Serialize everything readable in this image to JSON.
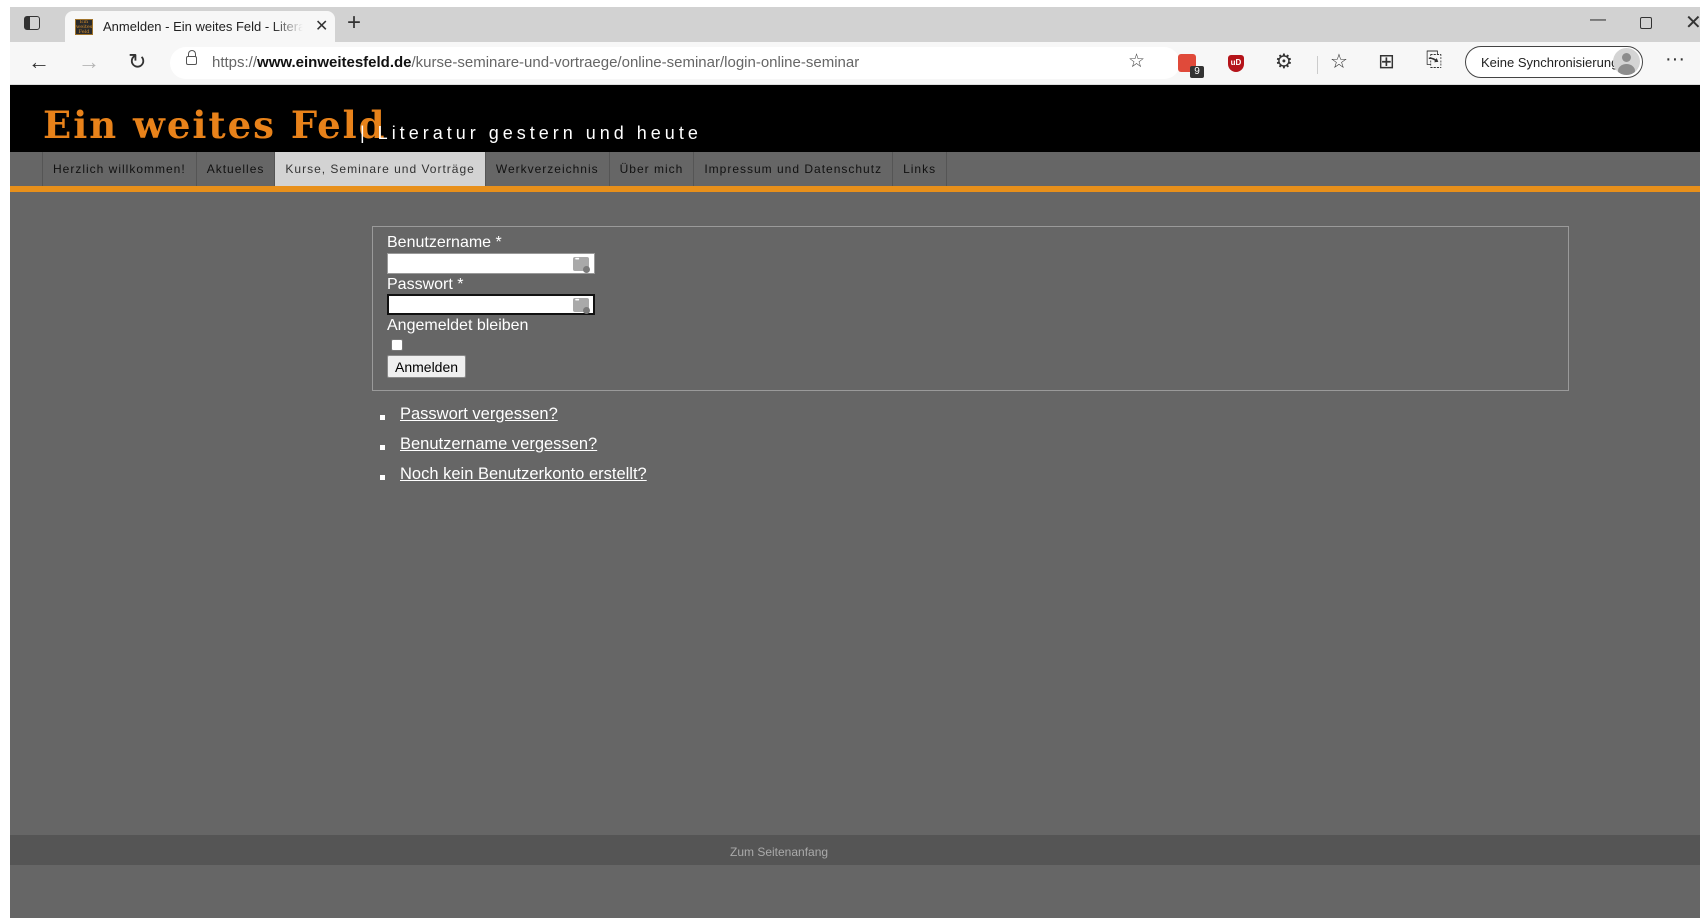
{
  "browser": {
    "tab_title": "Anmelden - Ein weites Feld - Literatur gestern und heute",
    "favicon_text": "Ein weites Feld",
    "url_prefix": "https://",
    "url_domain": "www.einweitesfeld.de",
    "url_path": "/kurse-seminare-und-vortraege/online-seminar/login-online-seminar",
    "sync_label": "Keine Synchronisierung",
    "extension_badge": "9",
    "extension_ublock_label": "uD",
    "icons": {
      "back": "←",
      "forward": "→",
      "reload": "↻",
      "new_tab": "+",
      "close": "✕",
      "minimize": "—",
      "more": "···",
      "favorites_add": "☆",
      "extensions": "⚙",
      "favorites": "☆",
      "collections": "⊞",
      "share": "⎘"
    }
  },
  "site": {
    "logo": "Ein weites Feld",
    "tagline": "| Literatur gestern und heute",
    "accent_color": "#e8901b",
    "nav": [
      {
        "label": "Herzlich willkommen!"
      },
      {
        "label": "Aktuelles"
      },
      {
        "label": "Kurse, Seminare und Vorträge"
      },
      {
        "label": "Werkverzeichnis"
      },
      {
        "label": "Über mich"
      },
      {
        "label": "Impressum und Datenschutz"
      },
      {
        "label": "Links"
      }
    ],
    "active_nav": "Kurse, Seminare und Vorträge"
  },
  "login": {
    "username_label": "Benutzername *",
    "username_value": "",
    "password_label": "Passwort *",
    "password_value": "",
    "remember_label": "Angemeldet bleiben",
    "remember_checked": false,
    "submit_label": "Anmelden"
  },
  "links": [
    {
      "label": "Passwort vergessen?"
    },
    {
      "label": "Benutzername vergessen?"
    },
    {
      "label": "Noch kein Benutzerkonto erstellt?"
    }
  ],
  "footer": {
    "text": "Zum Seitenanfang"
  }
}
